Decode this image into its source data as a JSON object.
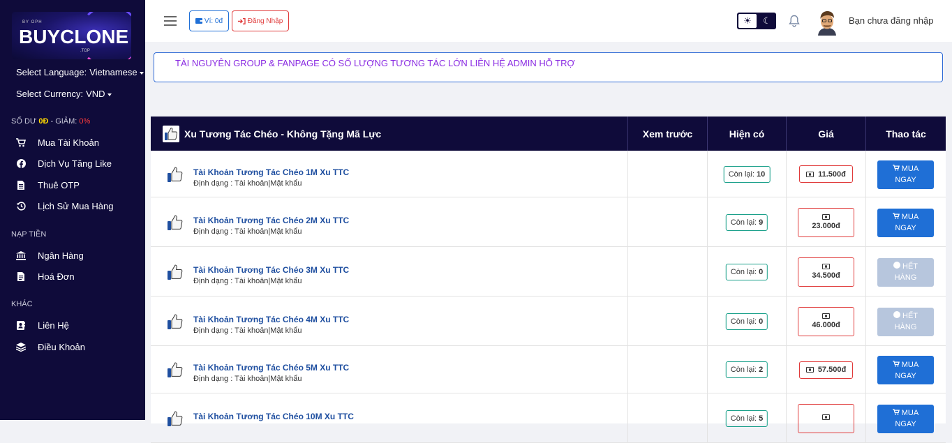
{
  "logo": {
    "small": "BY OPH",
    "big": "BUYCLONE",
    "top": ".TOP"
  },
  "sidebar": {
    "language_label": "Select Language:",
    "language_value": "Vietnamese",
    "currency_label": "Select Currency:",
    "currency_value": "VND",
    "balance": {
      "label": "SỐ DƯ",
      "amount": "0Đ",
      "sep": " - GIẢM: ",
      "discount": "0%"
    },
    "items": [
      {
        "label": "Mua Tài Khoản",
        "icon": "cart-icon"
      },
      {
        "label": "Dịch Vụ Tăng Like",
        "icon": "facebook-icon"
      },
      {
        "label": "Thuê OTP",
        "icon": "document-icon"
      },
      {
        "label": "Lịch Sử Mua Hàng",
        "icon": "history-icon"
      }
    ],
    "section_deposit": "NẠP TIỀN",
    "deposit_items": [
      {
        "label": "Ngân Hàng",
        "icon": "bank-icon"
      },
      {
        "label": "Hoá Đơn",
        "icon": "invoice-icon"
      }
    ],
    "section_other": "KHÁC",
    "other_items": [
      {
        "label": "Liên Hệ",
        "icon": "contact-icon"
      },
      {
        "label": "Điều Khoản",
        "icon": "layers-icon"
      }
    ]
  },
  "topbar": {
    "wallet_label": "Ví: 0đ",
    "login_label": "Đăng Nhập",
    "user_text": "Bạn chưa đăng nhập"
  },
  "notice": "TÀI NGUYÊN GROUP & FANPAGE CÓ SỐ LƯỢNG TƯƠNG TÁC LỚN LIÊN HỆ ADMIN HỖ TRỢ",
  "table": {
    "category_title": "Xu Tương Tác Chéo - Không Tặng Mã Lực",
    "col_preview": "Xem trước",
    "col_stock": "Hiện có",
    "col_price": "Giá",
    "col_action": "Thao tác",
    "stock_prefix": "Còn lại:",
    "buy_label_1": "MUA",
    "buy_label_2": "NGAY",
    "out_label_1": "HẾT",
    "out_label_2": "HÀNG",
    "rows": [
      {
        "name": "Tài Khoản Tương Tác Chéo 1M Xu TTC",
        "format": "Định dạng : Tài khoản|Mật khẩu",
        "stock": "10",
        "price": "11.500đ",
        "available": true
      },
      {
        "name": "Tài Khoản Tương Tác Chéo 2M Xu TTC",
        "format": "Định dạng : Tài khoản|Mật khẩu",
        "stock": "9",
        "price": "23.000đ",
        "available": true
      },
      {
        "name": "Tài Khoản Tương Tác Chéo 3M Xu TTC",
        "format": "Định dạng : Tài khoản|Mật khẩu",
        "stock": "0",
        "price": "34.500đ",
        "available": false
      },
      {
        "name": "Tài Khoản Tương Tác Chéo 4M Xu TTC",
        "format": "Định dạng : Tài khoản|Mật khẩu",
        "stock": "0",
        "price": "46.000đ",
        "available": false
      },
      {
        "name": "Tài Khoản Tương Tác Chéo 5M Xu TTC",
        "format": "Định dạng : Tài khoản|Mật khẩu",
        "stock": "2",
        "price": "57.500đ",
        "available": true
      },
      {
        "name": "Tài Khoản Tương Tác Chéo 10M Xu TTC",
        "format": "",
        "stock": "5",
        "price": "",
        "available": true
      }
    ]
  },
  "colors": {
    "sidebar_bg": "#0f0b3a",
    "primary": "#1f6fd6",
    "danger": "#e03a3a",
    "notice_text": "#8a2be2",
    "balance_amount": "#ffd800"
  }
}
